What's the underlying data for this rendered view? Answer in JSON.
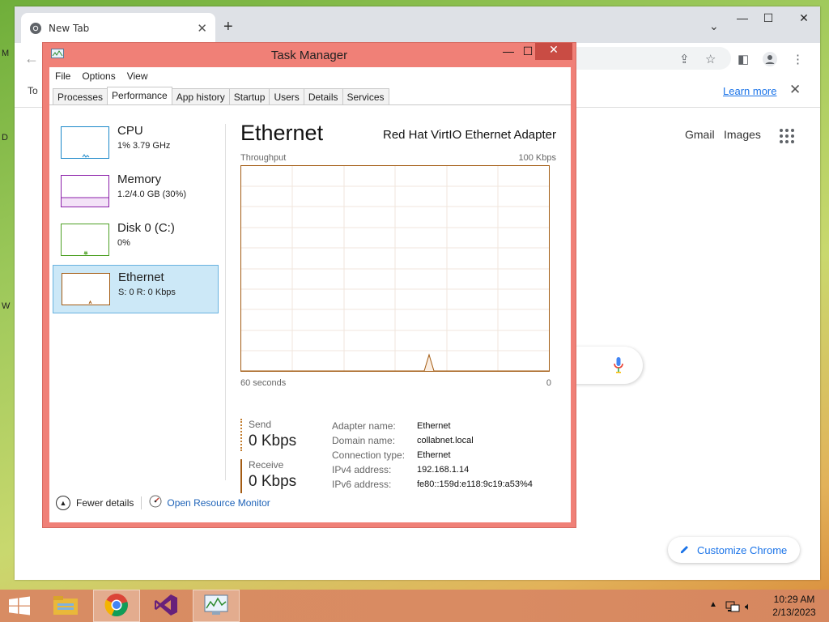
{
  "chrome": {
    "tab_title": "New Tab",
    "infobar_text": "To",
    "learn_more": "Learn more",
    "gmail": "Gmail",
    "images": "Images",
    "customize": "Customize Chrome",
    "win_min": "—",
    "win_max": "☐",
    "win_close": "✕"
  },
  "taskmanager": {
    "title": "Task Manager",
    "menus": [
      "File",
      "Options",
      "View"
    ],
    "tabs": [
      "Processes",
      "Performance",
      "App history",
      "Startup",
      "Users",
      "Details",
      "Services"
    ],
    "active_tab": "Performance",
    "sidebar": [
      {
        "name": "CPU",
        "sub": "1% 3.79 GHz",
        "color": "#1b88c9"
      },
      {
        "name": "Memory",
        "sub": "1.2/4.0 GB (30%)",
        "color": "#8b1fa9"
      },
      {
        "name": "Disk 0 (C:)",
        "sub": "0%",
        "color": "#4da024"
      },
      {
        "name": "Ethernet",
        "sub": "S: 0 R: 0 Kbps",
        "color": "#a35b12"
      }
    ],
    "heading": "Ethernet",
    "adapter": "Red Hat VirtIO Ethernet Adapter",
    "throughput_label": "Throughput",
    "max_label": "100 Kbps",
    "time_left": "60 seconds",
    "time_right": "0",
    "send_label": "Send",
    "send_value": "0 Kbps",
    "receive_label": "Receive",
    "receive_value": "0 Kbps",
    "info": [
      {
        "k": "Adapter name:",
        "v": "Ethernet"
      },
      {
        "k": "Domain name:",
        "v": "collabnet.local"
      },
      {
        "k": "Connection type:",
        "v": "Ethernet"
      },
      {
        "k": "IPv4 address:",
        "v": "192.168.1.14"
      },
      {
        "k": "IPv6 address:",
        "v": "fe80::159d:e118:9c19:a53%4"
      }
    ],
    "fewer_details": "Fewer details",
    "open_resource_monitor": "Open Resource Monitor"
  },
  "taskbar": {
    "time": "10:29 AM",
    "date": "2/13/2023"
  },
  "desktop": {
    "labels": [
      "M",
      "D",
      "W"
    ]
  }
}
